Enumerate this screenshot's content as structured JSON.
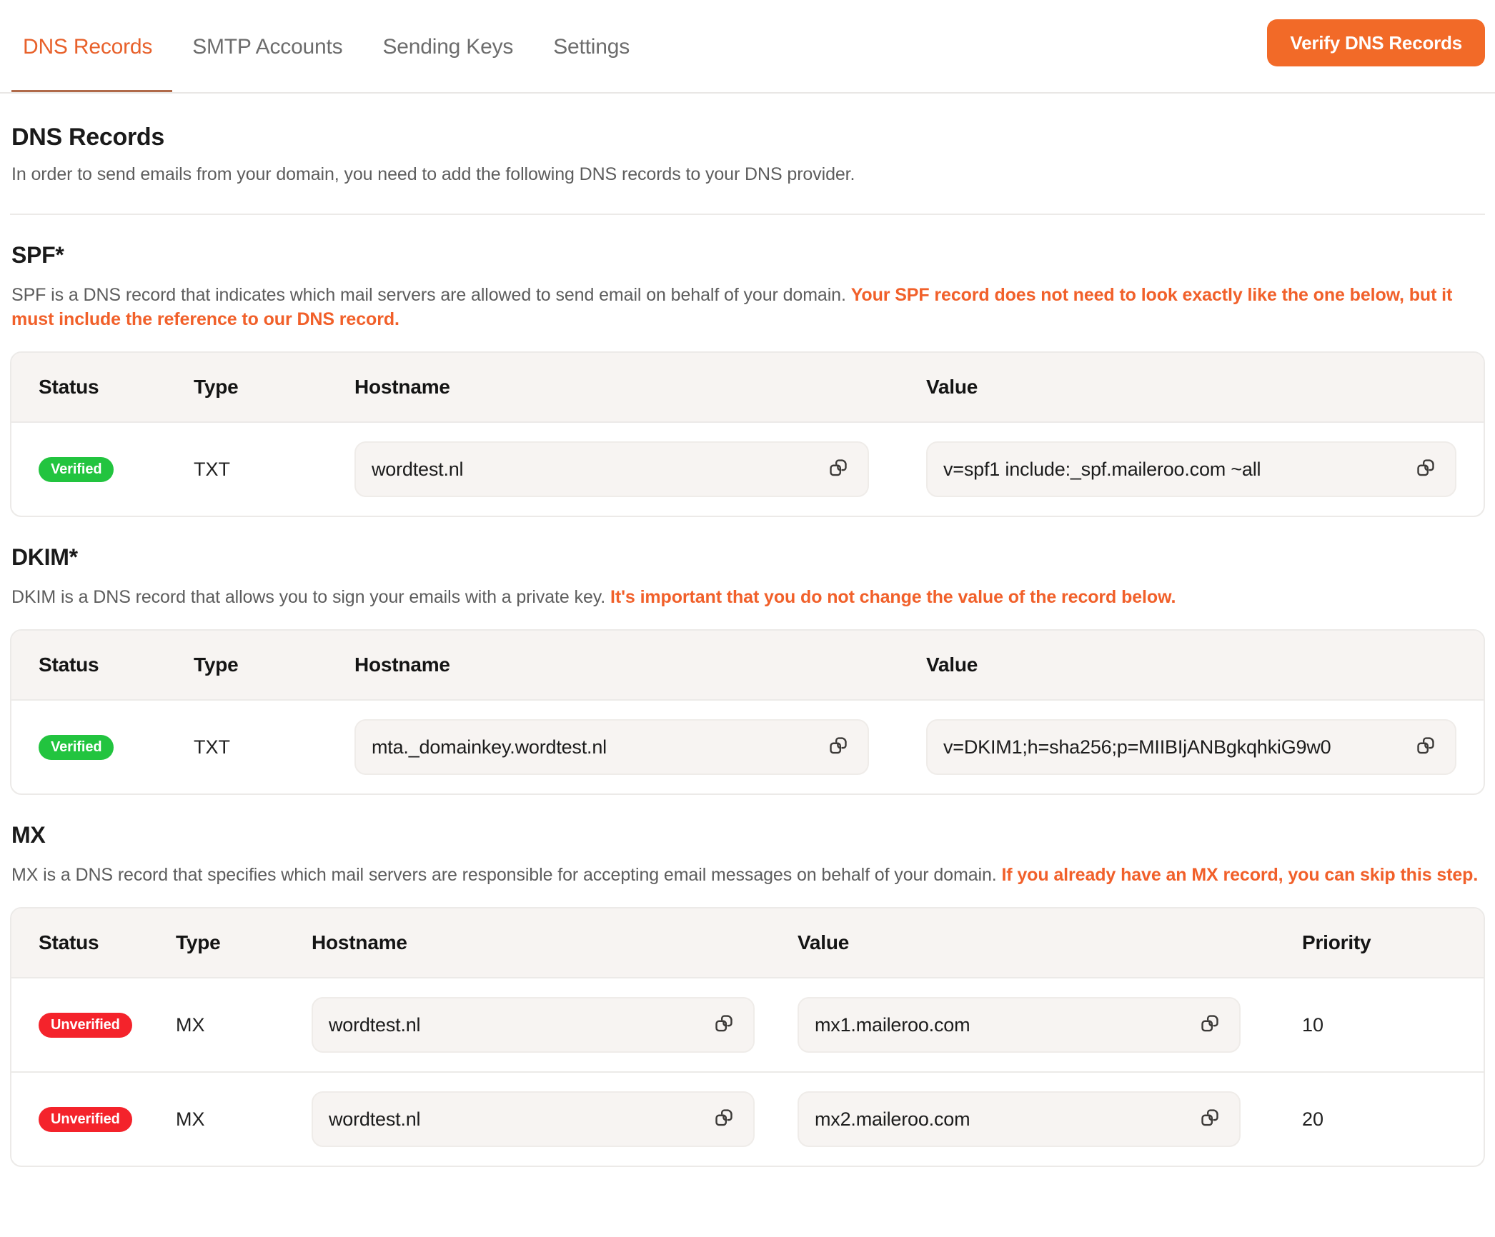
{
  "tabs": [
    {
      "label": "DNS Records",
      "active": true
    },
    {
      "label": "SMTP Accounts",
      "active": false
    },
    {
      "label": "Sending Keys",
      "active": false
    },
    {
      "label": "Settings",
      "active": false
    }
  ],
  "header": {
    "verify_button": "Verify DNS Records"
  },
  "page": {
    "title": "DNS Records",
    "subtitle": "In order to send emails from your domain, you need to add the following DNS records to your DNS provider."
  },
  "columns": {
    "status": "Status",
    "type": "Type",
    "hostname": "Hostname",
    "value": "Value",
    "priority": "Priority"
  },
  "sections": {
    "spf": {
      "title": "SPF*",
      "desc_plain": "SPF is a DNS record that indicates which mail servers are allowed to send email on behalf of your domain. ",
      "desc_highlight": "Your SPF record does not need to look exactly like the one below, but it must include the reference to our DNS record.",
      "rows": [
        {
          "status": "Verified",
          "status_kind": "verified",
          "type": "TXT",
          "hostname": "wordtest.nl",
          "value": "v=spf1 include:_spf.maileroo.com ~all"
        }
      ]
    },
    "dkim": {
      "title": "DKIM*",
      "desc_plain": "DKIM is a DNS record that allows you to sign your emails with a private key. ",
      "desc_highlight": "It's important that you do not change the value of the record below.",
      "rows": [
        {
          "status": "Verified",
          "status_kind": "verified",
          "type": "TXT",
          "hostname": "mta._domainkey.wordtest.nl",
          "value": "v=DKIM1;h=sha256;p=MIIBIjANBgkqhkiG9w0"
        }
      ]
    },
    "mx": {
      "title": "MX",
      "desc_plain": "MX is a DNS record that specifies which mail servers are responsible for accepting email messages on behalf of your domain. ",
      "desc_highlight": "If you already have an MX record, you can skip this step.",
      "rows": [
        {
          "status": "Unverified",
          "status_kind": "unverified",
          "type": "MX",
          "hostname": "wordtest.nl",
          "value": "mx1.maileroo.com",
          "priority": "10"
        },
        {
          "status": "Unverified",
          "status_kind": "unverified",
          "type": "MX",
          "hostname": "wordtest.nl",
          "value": "mx2.maileroo.com",
          "priority": "20"
        }
      ]
    }
  },
  "icons": {
    "copy": "copy-icon"
  },
  "colors": {
    "accent": "#f26a28",
    "highlight_text": "#f1602a",
    "verified": "#22c43f",
    "unverified": "#f4232b",
    "header_bg": "#f7f4f2",
    "border": "#eceae8"
  }
}
